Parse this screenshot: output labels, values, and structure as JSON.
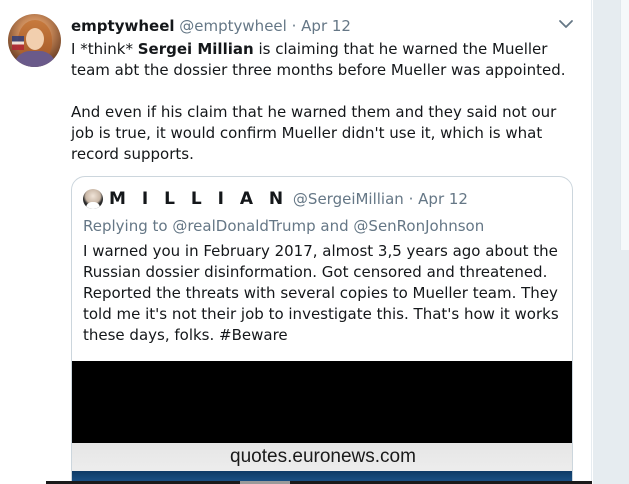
{
  "tweet": {
    "display_name": "emptywheel",
    "handle": "@emptywheel",
    "separator": "·",
    "date": "Apr 12",
    "text_p1_prefix": "I *think* ",
    "text_p1_bold": "Sergei Millian",
    "text_p1_suffix": " is claiming that he warned the Mueller team abt the dossier three months before Mueller was appointed.",
    "text_p2": "And even if his claim that he warned them and they said not our job is true, it would confirm Mueller didn't use it, which is what record supports.",
    "caret_icon": "chevron-down-icon",
    "accent_color": "#1da1f2"
  },
  "quoted_tweet": {
    "display_name": "M I L L I A N",
    "handle": "@SergeiMillian",
    "separator": "·",
    "date": "Apr 12",
    "reply_prefix": "Replying to ",
    "reply_to_1": "@realDonaldTrump",
    "reply_and": " and ",
    "reply_to_2": "@SenRonJohnson",
    "text": "I warned you in February 2017, almost 3,5 years ago about the Russian dossier disinformation. Got censored and threatened. Reported the threats with several copies to Mueller team. They told me it's not their job to investigate this. That's how it works these days, folks. #Beware",
    "media_caption": "quotes.euronews.com"
  }
}
